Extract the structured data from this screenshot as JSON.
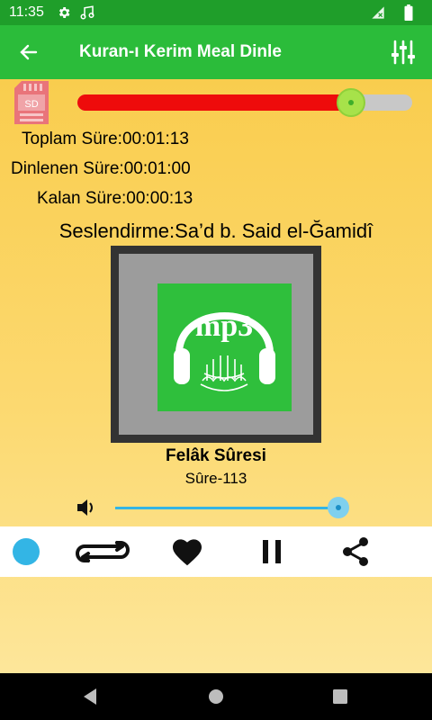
{
  "status_bar": {
    "time": "11:35",
    "icons": [
      "gear-icon",
      "music-note-icon",
      "no-signal-icon",
      "battery-icon"
    ]
  },
  "app_bar": {
    "title": "Kuran-ı Kerim Meal Dinle",
    "back_icon": "arrow-left-icon",
    "menu_icon": "equalizer-icon",
    "color": "#2bbc3a"
  },
  "storage": {
    "label": "SD",
    "icon": "sd-card-icon"
  },
  "progress": {
    "fraction": 0.818,
    "played_color": "#ee0b0b"
  },
  "info": {
    "total": "Toplam Süre:00:01:13",
    "played": "Dinlenen Süre:00:01:00",
    "remaining": "Kalan Süre:00:00:13"
  },
  "reciter": "Seslendirme:Sa’d b. Said el-Ğamidî",
  "cover": {
    "text": "mp3",
    "icon": "headphones-mp3-icon"
  },
  "track": {
    "name": "Felâk Sûresi",
    "number": "Sûre-113"
  },
  "volume": {
    "level": 1.0,
    "icon": "volume-icon"
  },
  "controls": [
    "status-dot",
    "repeat-icon",
    "heart-icon",
    "pause-icon",
    "share-icon"
  ],
  "nav": [
    "back-triangle-icon",
    "home-circle-icon",
    "recents-square-icon"
  ]
}
